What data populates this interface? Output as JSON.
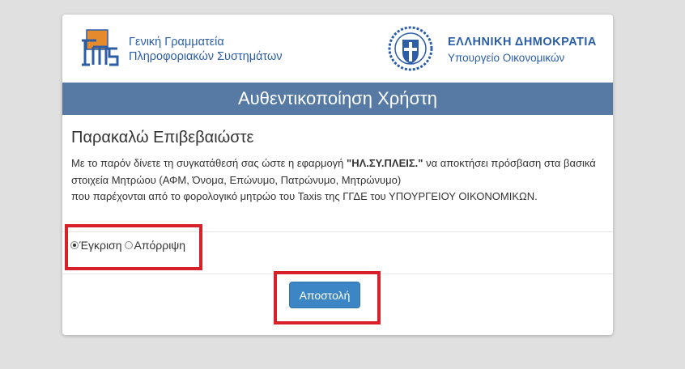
{
  "header": {
    "gsis_line1": "Γενική Γραμματεία",
    "gsis_line2": "Πληροφοριακών Συστημάτων",
    "republic_line1": "ΕΛΛΗΝΙΚΗ ΔΗΜΟΚΡΑΤΙΑ",
    "republic_line2": "Υπουργείο Οικονομικών"
  },
  "title": "Αυθεντικοποίηση Χρήστη",
  "consent": {
    "heading": "Παρακαλώ Επιβεβαιώστε",
    "text_part1": "Με το παρόν δίνετε τη συγκατάθεσή σας ώστε η εφαρμογή ",
    "app_name": "\"ΗΛ.ΣΥ.ΠΛΕΙΣ.\"",
    "text_part2": " να αποκτήσει πρόσβαση στα βασικά στοιχεία Μητρώου (ΑΦΜ, Όνομα, Επώνυμο, Πατρώνυμο, Μητρώνυμο)",
    "text_line3": "που παρέχονται από το φορολογικό μητρώο του Taxis της ΓΓΔΕ του ΥΠΟΥΡΓΕΙΟΥ ΟΙΚΟΝΟΜΙΚΩΝ."
  },
  "options": {
    "approve_label": "Έγκριση",
    "reject_label": "Απόρριψη",
    "selected": "approve"
  },
  "submit_label": "Αποστολή",
  "colors": {
    "title_bar": "#567aa3",
    "brand_blue": "#2b5ea7",
    "button": "#3d86c6",
    "highlight": "#d8202b"
  }
}
